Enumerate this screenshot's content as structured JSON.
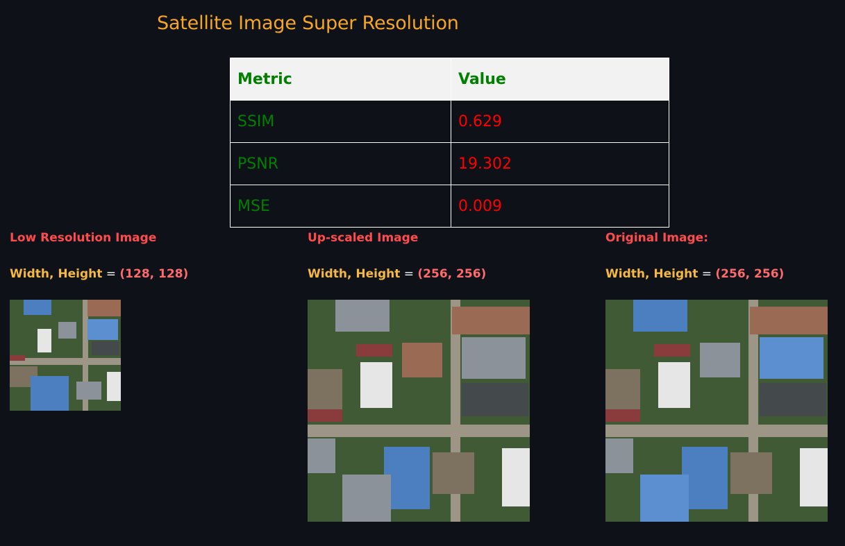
{
  "app": {
    "title": "Satellite Image Super Resolution"
  },
  "metrics_table": {
    "headers": [
      "Metric",
      "Value"
    ],
    "rows": [
      {
        "metric": "SSIM",
        "value": "0.629"
      },
      {
        "metric": "PSNR",
        "value": "19.302"
      },
      {
        "metric": "MSE",
        "value": "0.009"
      }
    ],
    "colors": {
      "header_bg": "#f2f2f2",
      "metric_text": "#008000",
      "value_text": "#ff0000"
    }
  },
  "panels": [
    {
      "heading": "Low Resolution Image",
      "dims_label": "Width, Height",
      "equals": " = ",
      "dims_value": "(128, 128)"
    },
    {
      "heading": "Up-scaled Image",
      "dims_label": "Width, Height",
      "equals": " = ",
      "dims_value": "(256, 256)"
    },
    {
      "heading": "Original Image:",
      "dims_label": "Width, Height",
      "equals": " = ",
      "dims_value": "(256, 256)"
    }
  ],
  "theme": {
    "background": "#0e1117",
    "title_color": "#f5a623",
    "heading_color": "#ff4b4b",
    "dims_label_color": "#f5b942",
    "dims_value_color": "#ff6b6b"
  }
}
